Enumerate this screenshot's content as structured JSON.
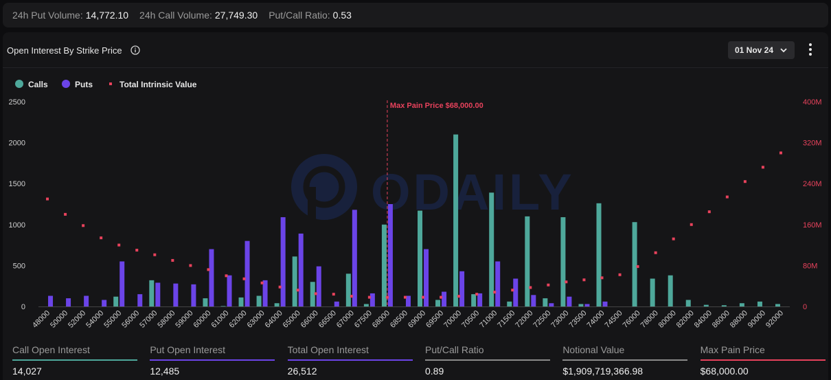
{
  "topbar": {
    "put_volume_label": "24h Put Volume:",
    "put_volume": "14,772.10",
    "call_volume_label": "24h Call Volume:",
    "call_volume": "27,749.30",
    "ratio_label": "Put/Call Ratio:",
    "ratio": "0.53"
  },
  "panel": {
    "title": "Open Interest By Strike Price",
    "date": "01 Nov 24",
    "info_icon": "info-icon",
    "more_icon": "more-vertical-icon"
  },
  "colors": {
    "calls": "#4ea89b",
    "puts": "#6b44e8",
    "intrinsic": "#e8425c",
    "max_pain": "#e8425c",
    "grey": "#8a8a8a"
  },
  "chart_data": {
    "type": "bar",
    "legend": [
      "Calls",
      "Puts",
      "Total Intrinsic Value"
    ],
    "legend_position": "top-left",
    "annotation": "Max Pain Price $68,000.00",
    "max_pain_strike": "68000",
    "y_ticks": [
      "0",
      "500",
      "1000",
      "1500",
      "2000",
      "2500"
    ],
    "y2_ticks": [
      "0",
      "80M",
      "160M",
      "240M",
      "320M",
      "400M"
    ],
    "ylim": [
      0,
      2500
    ],
    "y2lim": [
      0,
      400
    ],
    "y2_unit": "M",
    "grid": false,
    "categories": [
      "48000",
      "50000",
      "52000",
      "54000",
      "55000",
      "56000",
      "57000",
      "58000",
      "59000",
      "60000",
      "61000",
      "62000",
      "63000",
      "64000",
      "65000",
      "66000",
      "66500",
      "67000",
      "67500",
      "68000",
      "68500",
      "69000",
      "69500",
      "70000",
      "70500",
      "71000",
      "71500",
      "72000",
      "72500",
      "73000",
      "73500",
      "74000",
      "74500",
      "76000",
      "78000",
      "80000",
      "82000",
      "84000",
      "86000",
      "88000",
      "90000",
      "92000"
    ],
    "series": [
      {
        "name": "Calls",
        "values": [
          0,
          0,
          0,
          0,
          120,
          0,
          320,
          0,
          0,
          100,
          5,
          110,
          130,
          40,
          610,
          300,
          0,
          400,
          30,
          1000,
          0,
          1170,
          80,
          2100,
          150,
          1390,
          60,
          1100,
          100,
          1090,
          30,
          1260,
          0,
          1030,
          340,
          380,
          80,
          20,
          15,
          40,
          60,
          30
        ]
      },
      {
        "name": "Puts",
        "values": [
          130,
          100,
          130,
          80,
          550,
          150,
          290,
          280,
          270,
          700,
          380,
          800,
          320,
          1090,
          890,
          490,
          60,
          1180,
          160,
          1250,
          130,
          700,
          180,
          430,
          160,
          550,
          340,
          140,
          40,
          120,
          30,
          60,
          0,
          0,
          0,
          0,
          0,
          0,
          0,
          0,
          0,
          0
        ]
      },
      {
        "name": "Total Intrinsic Value",
        "values": [
          210,
          180,
          158,
          134,
          120,
          110,
          101,
          90,
          80,
          72,
          60,
          54,
          46,
          38,
          32,
          25,
          24,
          20,
          18,
          18,
          18,
          18,
          18,
          20,
          24,
          28,
          32,
          37,
          42,
          48,
          52,
          56,
          62,
          78,
          105,
          132,
          160,
          185,
          214,
          244,
          272,
          300
        ]
      }
    ]
  },
  "footer": [
    {
      "label": "Call Open Interest",
      "value": "14,027",
      "color": "#4ea89b"
    },
    {
      "label": "Put Open Interest",
      "value": "12,485",
      "color": "#6b44e8"
    },
    {
      "label": "Total Open Interest",
      "value": "26,512",
      "color": "#6b44e8"
    },
    {
      "label": "Put/Call Ratio",
      "value": "0.89",
      "color": "#8a8a8a"
    },
    {
      "label": "Notional Value",
      "value": "$1,909,719,366.98",
      "color": "#8a8a8a"
    },
    {
      "label": "Max Pain Price",
      "value": "$68,000.00",
      "color": "#e8425c"
    }
  ],
  "watermark": "ODAILY"
}
